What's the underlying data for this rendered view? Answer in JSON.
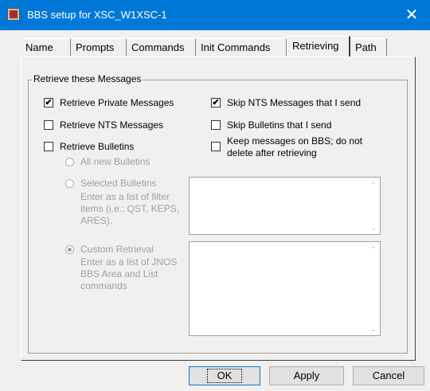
{
  "window": {
    "title": "BBS setup for XSC_W1XSC-1",
    "close_glyph": "✕"
  },
  "tabs": [
    {
      "label": "Name"
    },
    {
      "label": "Prompts"
    },
    {
      "label": "Commands"
    },
    {
      "label": "Init Commands"
    },
    {
      "label": "Retrieving",
      "active": true
    },
    {
      "label": "Path"
    }
  ],
  "group": {
    "label": "Retrieve these Messages",
    "checkboxes": {
      "retrieve_private": {
        "label": "Retrieve Private Messages",
        "checked": true
      },
      "retrieve_nts": {
        "label": "Retrieve NTS Messages",
        "checked": false
      },
      "retrieve_bulletins": {
        "label": "Retrieve Bulletins",
        "checked": false
      },
      "skip_nts": {
        "label": "Skip NTS Messages that I send",
        "checked": true
      },
      "skip_bulletins": {
        "label": "Skip Bulletins that I send",
        "checked": false
      },
      "keep_messages": {
        "label_line1": "Keep messages on BBS; do not",
        "label_line2": "delete after retrieving",
        "checked": false
      }
    },
    "radios": {
      "all_new": {
        "label": "All new Bulletins"
      },
      "selected": {
        "label": "Selected Bulletins",
        "hint_line1": "Enter as a list of filter",
        "hint_line2": "items (i.e.: QST, KEPS,",
        "hint_line3": "ARES)."
      },
      "custom": {
        "label": "Custom Retrieval",
        "selected": true,
        "hint_line1": "Enter as a list of JNOS",
        "hint_line2": "BBS Area and List",
        "hint_line3": "commands"
      }
    },
    "check_glyph": "✔",
    "scroll_up_glyph": "⌃",
    "scroll_down_glyph": "⌄"
  },
  "buttons": {
    "ok": "OK",
    "apply": "Apply",
    "cancel": "Cancel"
  },
  "colors": {
    "titlebar": "#0078d7",
    "disabled_text": "#a0a0a0",
    "dialog_bg": "#f0f0f0"
  }
}
